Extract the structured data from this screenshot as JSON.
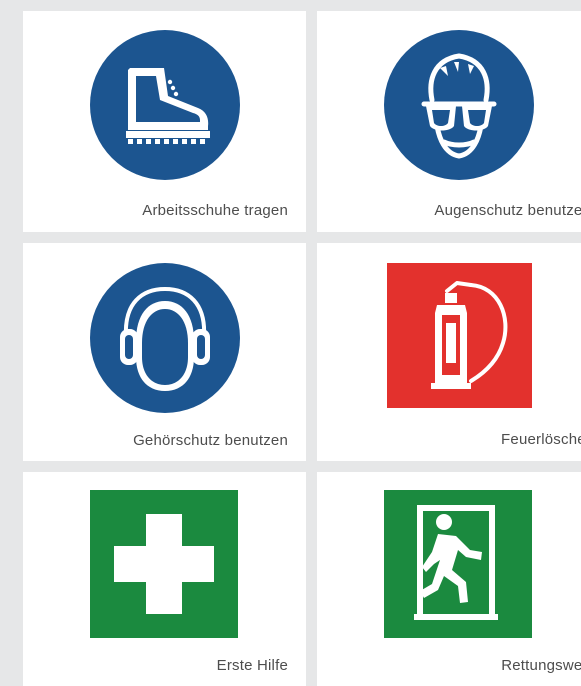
{
  "signs": [
    {
      "caption": "Arbeitsschuhe tragen",
      "icon": "work-boots-icon",
      "color": "#1c5590"
    },
    {
      "caption": "Augenschutz benutzen",
      "icon": "safety-goggles-icon",
      "color": "#1c5590"
    },
    {
      "caption": "Gehörschutz benutzen",
      "icon": "hearing-protection-icon",
      "color": "#1c5590"
    },
    {
      "caption": "Feuerlöscher",
      "icon": "fire-extinguisher-icon",
      "color": "#e3312d"
    },
    {
      "caption": "Erste Hilfe",
      "icon": "first-aid-cross-icon",
      "color": "#1b8a3f"
    },
    {
      "caption": "Rettungsweg",
      "icon": "emergency-exit-icon",
      "color": "#1b8a3f"
    }
  ]
}
